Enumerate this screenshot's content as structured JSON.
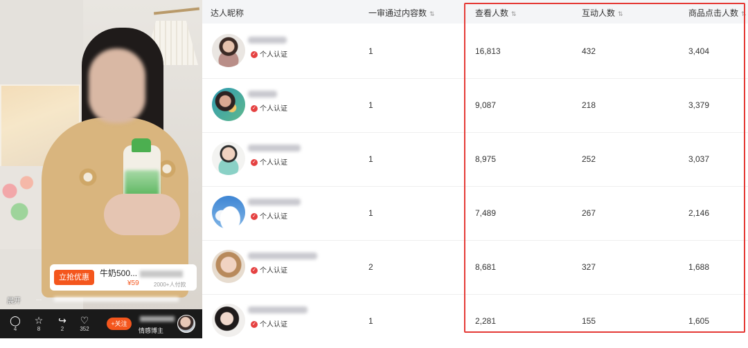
{
  "video": {
    "promo_button_label": "立抢优惠",
    "product_title": "牛奶500...",
    "price": "¥59",
    "sold_text": "2000+人付款",
    "caption_expand": "展开",
    "caption_ellipsis": "...",
    "follow_label": "+关注",
    "host_name": "情感博主",
    "actions": [
      {
        "icon": "comment-icon",
        "glyph": "◯",
        "count": "4"
      },
      {
        "icon": "star-icon",
        "glyph": "☆",
        "count": "8"
      },
      {
        "icon": "share-icon",
        "glyph": "↪",
        "count": "2"
      },
      {
        "icon": "heart-icon",
        "glyph": "♡",
        "count": "352"
      }
    ]
  },
  "table": {
    "headers": {
      "nickname": "达人昵称",
      "first_review": "一审通过内容数",
      "views": "查看人数",
      "interactions": "互动人数",
      "product_clicks": "商品点击人数"
    },
    "sort_glyph": "⇅",
    "verify_label": "个人认证",
    "verify_icon_glyph": "✓",
    "rows": [
      {
        "first_review": "1",
        "views": "16,813",
        "interactions": "432",
        "product_clicks": "3,404"
      },
      {
        "first_review": "1",
        "views": "9,087",
        "interactions": "218",
        "product_clicks": "3,379"
      },
      {
        "first_review": "1",
        "views": "8,975",
        "interactions": "252",
        "product_clicks": "3,037"
      },
      {
        "first_review": "1",
        "views": "7,489",
        "interactions": "267",
        "product_clicks": "2,146"
      },
      {
        "first_review": "2",
        "views": "8,681",
        "interactions": "327",
        "product_clicks": "1,688"
      },
      {
        "first_review": "1",
        "views": "2,281",
        "interactions": "155",
        "product_clicks": "1,605"
      }
    ]
  },
  "colors": {
    "accent_orange": "#f4561d",
    "highlight_red": "#e53935",
    "verify_red": "#e54141"
  }
}
